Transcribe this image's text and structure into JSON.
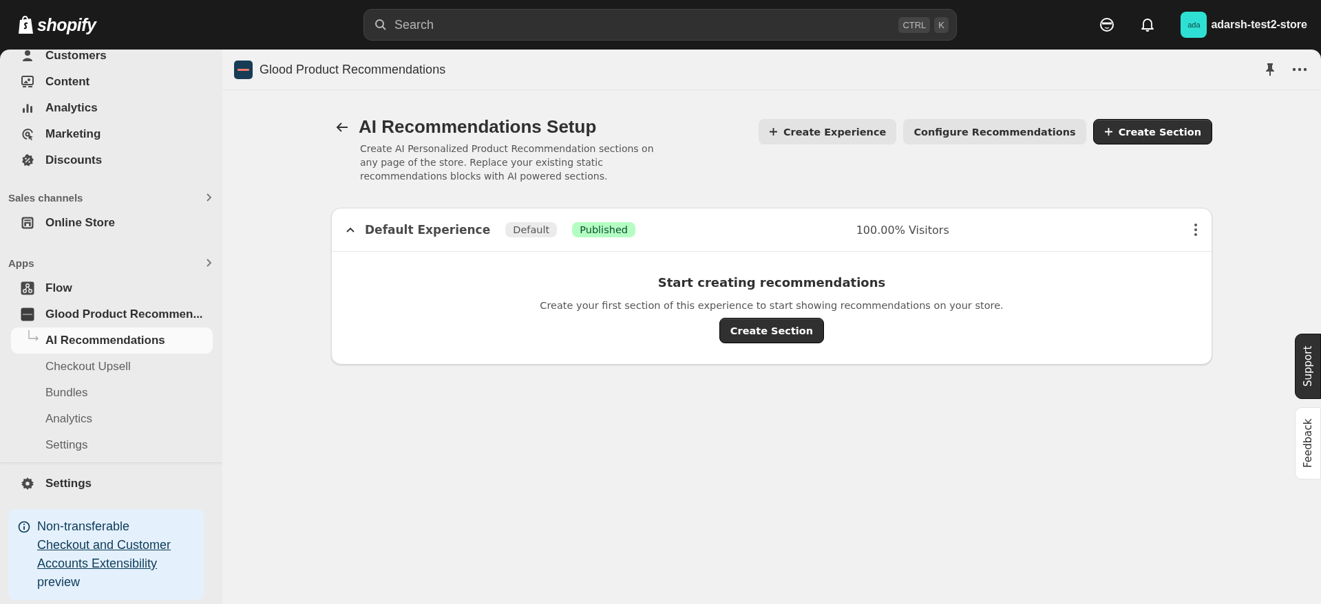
{
  "topbar": {
    "logo_text": "shopify",
    "search": {
      "placeholder": "Search",
      "keys": [
        "CTRL",
        "K"
      ]
    },
    "store": {
      "avatar": "ada",
      "name": "adarsh-test2-store"
    }
  },
  "sidebar": {
    "nav": [
      {
        "label": "Customers"
      },
      {
        "label": "Content"
      },
      {
        "label": "Analytics"
      },
      {
        "label": "Marketing"
      },
      {
        "label": "Discounts"
      }
    ],
    "sales_channels": {
      "title": "Sales channels",
      "items": [
        {
          "label": "Online Store"
        }
      ]
    },
    "apps": {
      "title": "Apps",
      "items": [
        {
          "label": "Flow"
        },
        {
          "label": "Glood Product Recommen...",
          "children": [
            {
              "label": "AI Recommendations",
              "selected": true
            },
            {
              "label": "Checkout Upsell",
              "selected": false
            },
            {
              "label": "Bundles",
              "selected": false
            },
            {
              "label": "Analytics",
              "selected": false
            },
            {
              "label": "Settings",
              "selected": false
            }
          ]
        }
      ]
    },
    "settings": {
      "label": "Settings"
    },
    "banner": {
      "text": "Non-transferable",
      "link": "Checkout and Customer Accounts Extensibility",
      "suffix": "preview"
    }
  },
  "app_header": {
    "title": "Glood Product Recommendations"
  },
  "page": {
    "title": "AI Recommendations Setup",
    "description": "Create AI Personalized Product Recommendation sections on any page of the store. Replace your existing static recommendations blocks with AI powered sections.",
    "buttons": [
      {
        "label": "Create Experience",
        "kind": "secondary",
        "plus": true
      },
      {
        "label": "Configure Recommendations",
        "kind": "secondary",
        "plus": false
      },
      {
        "label": "Create Section",
        "kind": "primary",
        "plus": true
      }
    ]
  },
  "experience": {
    "title": "Default Experience",
    "expanded": true,
    "badges": [
      {
        "label": "Default",
        "kind": "neutral"
      },
      {
        "label": "Published",
        "kind": "success"
      }
    ],
    "visitors": "100.00% Visitors",
    "empty_state": {
      "title": "Start creating recommendations",
      "text": "Create your first section of this experience to start showing recommendations on your store.",
      "button": "Create Section"
    }
  },
  "side_tabs": [
    {
      "label": "Support",
      "kind": "dark"
    },
    {
      "label": "Feedback",
      "kind": "light"
    }
  ]
}
